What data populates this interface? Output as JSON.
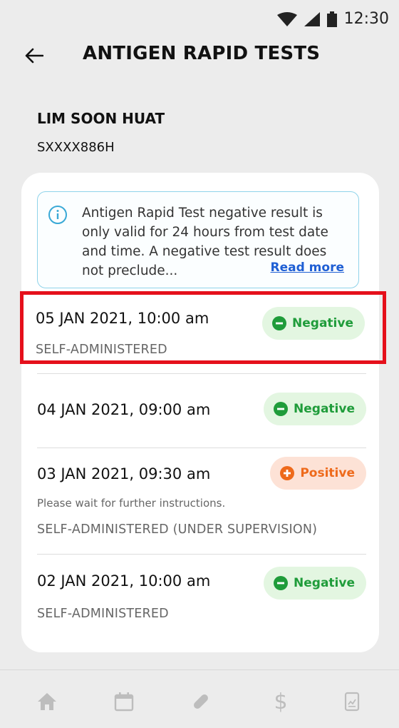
{
  "status_bar": {
    "time": "12:30"
  },
  "header": {
    "title": "ANTIGEN RAPID TESTS"
  },
  "patient": {
    "name": "LIM SOON HUAT",
    "id": "SXXXX886H"
  },
  "info": {
    "text": "Antigen Rapid Test negative result is only valid for 24 hours from test date and time. A negative test result does not preclude...",
    "read_more": "Read more"
  },
  "tests": [
    {
      "date": "05 JAN 2021, 10:00 am",
      "result": "Negative",
      "method": "SELF-ADMINISTERED",
      "note": ""
    },
    {
      "date": "04 JAN 2021, 09:00 am",
      "result": "Negative",
      "method": "",
      "note": ""
    },
    {
      "date": "03 JAN 2021, 09:30 am",
      "result": "Positive",
      "method": "SELF-ADMINISTERED (UNDER SUPERVISION)",
      "note": "Please wait for further instructions."
    },
    {
      "date": "02 JAN 2021, 10:00 am",
      "result": "Negative",
      "method": "SELF-ADMINISTERED",
      "note": ""
    }
  ],
  "colors": {
    "negative_text": "#1f9c3a",
    "negative_bg": "#e3f6e1",
    "positive_text": "#ee6a1b",
    "positive_bg": "#fde2d6",
    "link": "#1f5fd4",
    "highlight": "#e5101b"
  },
  "nav": {
    "items": [
      {
        "icon": "home-icon"
      },
      {
        "icon": "calendar-icon"
      },
      {
        "icon": "pill-icon"
      },
      {
        "icon": "dollar-icon",
        "label": "$"
      },
      {
        "icon": "report-icon"
      }
    ]
  }
}
